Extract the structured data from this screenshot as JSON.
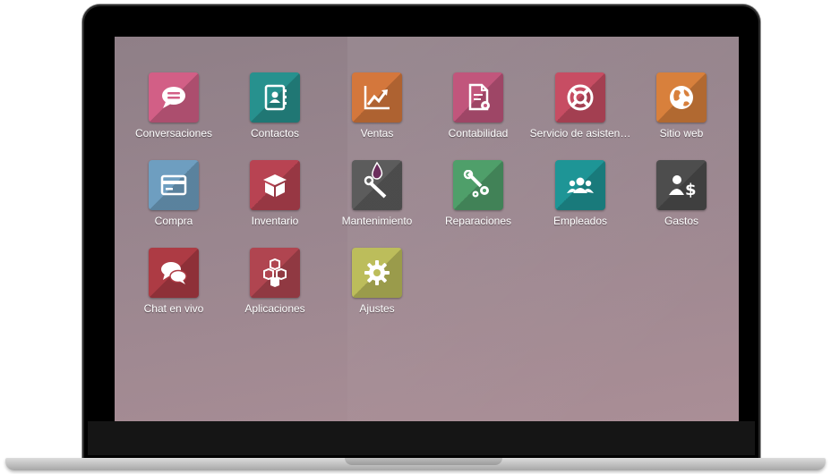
{
  "apps": [
    {
      "label": "Conversaciones",
      "icon": "chat-bubble-icon",
      "color": "#d25f86"
    },
    {
      "label": "Contactos",
      "icon": "address-book-icon",
      "color": "#27918e"
    },
    {
      "label": "Ventas",
      "icon": "trend-chart-icon",
      "color": "#d4773c"
    },
    {
      "label": "Contabilidad",
      "icon": "invoice-gear-icon",
      "color": "#c1567c"
    },
    {
      "label": "Servicio de asisten…",
      "icon": "lifebuoy-icon",
      "color": "#c74d63"
    },
    {
      "label": "Sitio web",
      "icon": "globe-icon",
      "color": "#d8803c"
    },
    {
      "label": "Compra",
      "icon": "credit-card-icon",
      "color": "#6e9ec0"
    },
    {
      "label": "Inventario",
      "icon": "box-icon",
      "color": "#b84352"
    },
    {
      "label": "Mantenimiento",
      "icon": "wrench-drop-icon",
      "color": "#5c5c5c"
    },
    {
      "label": "Reparaciones",
      "icon": "wrench-gears-icon",
      "color": "#4f9f6a"
    },
    {
      "label": "Empleados",
      "icon": "people-icon",
      "color": "#1e9596"
    },
    {
      "label": "Gastos",
      "icon": "person-dollar-icon",
      "color": "#4d4d4d"
    },
    {
      "label": "Chat en vivo",
      "icon": "chat-bubbles-icon",
      "color": "#ad3b44"
    },
    {
      "label": "Aplicaciones",
      "icon": "cubes-icon",
      "color": "#b04550"
    },
    {
      "label": "Ajustes",
      "icon": "gear-icon",
      "color": "#bcbd5b"
    }
  ]
}
